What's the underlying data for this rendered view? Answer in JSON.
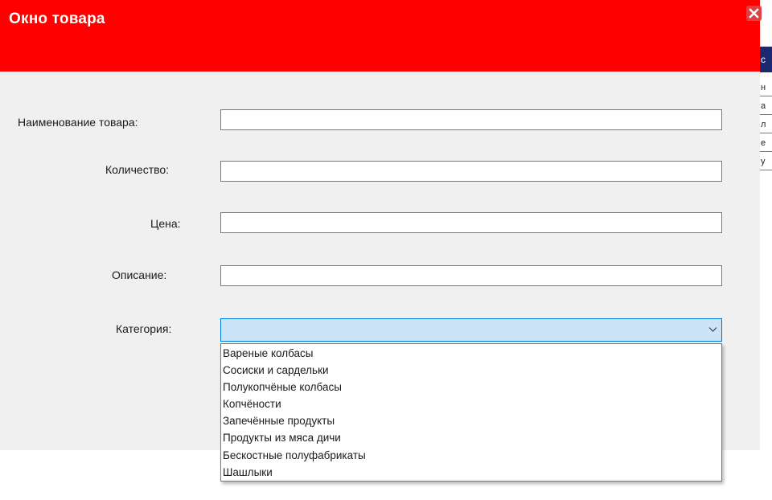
{
  "window": {
    "title": "Окно товара",
    "close_icon": "close-icon"
  },
  "form": {
    "name_label": "Наименование товара:",
    "quantity_label": "Количество:",
    "price_label": "Цена:",
    "description_label": "Описание:",
    "category_label": "Категория:",
    "name_value": "",
    "quantity_value": "",
    "price_value": "",
    "description_value": "",
    "category_value": ""
  },
  "category_options": [
    "Вареные колбасы",
    "Сосиски и сардельки",
    "Полукопчёные колбасы",
    "Копчёности",
    "Запечённые продукты",
    "Продукты из мяса дичи",
    "Бескостные полуфабрикаты",
    "Шашлыки"
  ],
  "background_window": {
    "header_letter": "с",
    "rows": [
      "н",
      "а",
      "л",
      "е",
      "у"
    ]
  },
  "colors": {
    "title_bar": "#ff0000",
    "dialog_bg": "#f0f0f0",
    "combo_bg": "#cce4f7",
    "combo_border": "#0078d7",
    "bg_header": "#1b2a70"
  }
}
